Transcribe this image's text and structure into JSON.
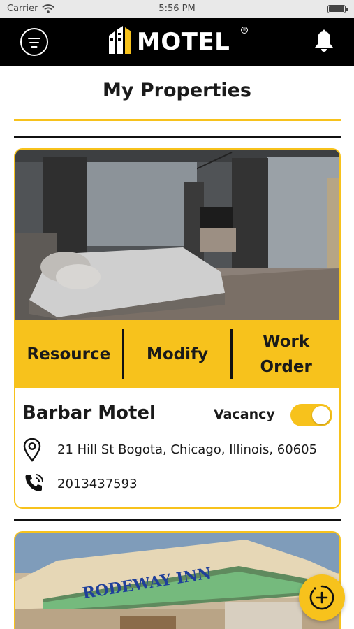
{
  "status_bar": {
    "carrier": "Carrier",
    "time": "5:56 PM"
  },
  "header": {
    "brand": "MOTEL"
  },
  "page": {
    "title": "My Properties"
  },
  "properties": [
    {
      "actions": {
        "resource": "Resource",
        "modify": "Modify",
        "work_order": "Work Order"
      },
      "name": "Barbar Motel",
      "vacancy_label": "Vacancy",
      "vacancy_on": true,
      "address": "21 Hill St Bogota, Chicago, Illinois, 60605",
      "phone": "2013437593"
    },
    {
      "sign_text": "RODEWAY INN"
    }
  ],
  "colors": {
    "accent": "#f7c21c",
    "header_bg": "#000000",
    "text": "#1a1a1a"
  },
  "icons": [
    "menu-icon",
    "bell-icon",
    "location-pin-icon",
    "phone-icon",
    "add-circle-icon",
    "wifi-icon",
    "battery-icon"
  ]
}
